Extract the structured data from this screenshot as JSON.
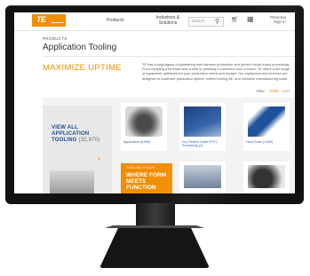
{
  "topnav": {
    "logo_text": "TE",
    "products": "Products",
    "industries_line1": "Industries &",
    "industries_line2": "Solutions",
    "search_placeholder": "Search",
    "account_line1": "Personal",
    "account_line2": "Sign in"
  },
  "breadcrumb": "PRODUCTS",
  "page_title": "Application Tooling",
  "hero": {
    "heading": "MAXIMIZE UPTIME",
    "text": "TE has a long legacy of pioneering wire harness production and printed circuit board processing. From crimping a terminal onto a wire or pressing a connector onto a board, TE offers a full range of equipment optimized for your production needs and budget. Our equipment and services are designed to maximize production uptime, extend tooling life, and minimize manufacturing costs."
  },
  "view_toggle": {
    "label": "View",
    "grid": "GRID",
    "list": "LIST"
  },
  "view_all": {
    "text": "VIEW ALL APPLICATION TOOLING",
    "count": "(32,970)",
    "arrow": "›"
  },
  "products": [
    {
      "caption": "Applicators (6,095)"
    },
    {
      "caption": "Dry Flexible Cable (FFC) Processing (1)"
    },
    {
      "caption": "Hand Tools (1,600)"
    },
    {
      "caption": ""
    },
    {
      "caption": ""
    }
  ],
  "promo": {
    "top": "TOOLING FOCUS",
    "text": "WHERE FORM MEETS FUNCTION"
  },
  "colors": {
    "brand_orange": "#f28d00",
    "link_blue": "#1a4d8c"
  },
  "icons": [
    "search-icon",
    "cart-icon",
    "grid-icon"
  ]
}
